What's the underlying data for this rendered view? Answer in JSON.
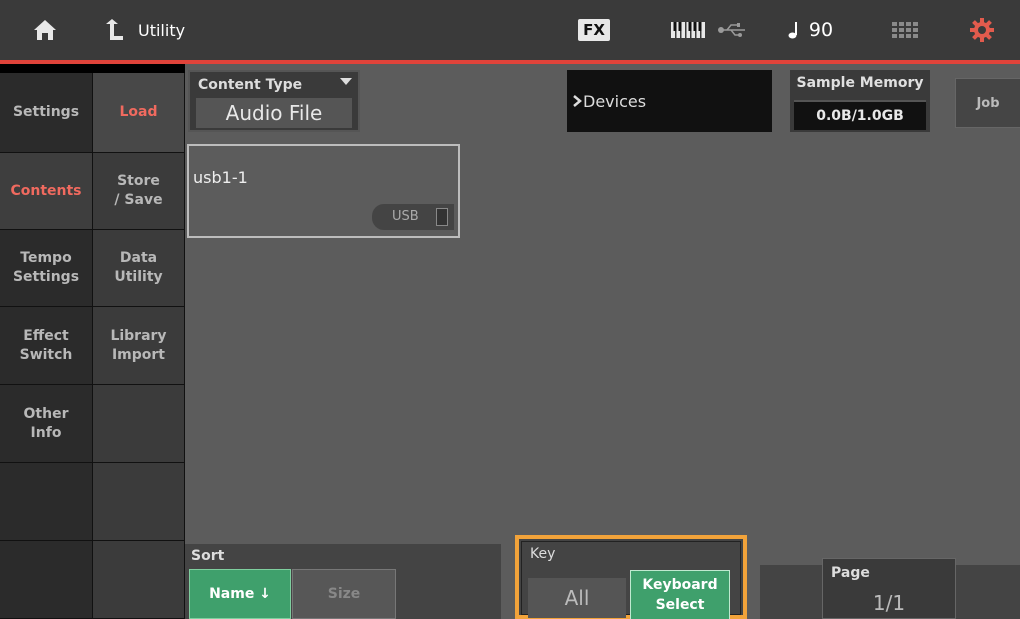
{
  "header": {
    "title": "Utility",
    "fx_label": "FX",
    "tempo": "90",
    "icons": [
      "home-icon",
      "back-arrow-icon",
      "keyboard-icon",
      "usb-icon",
      "note-icon",
      "grid-icon",
      "gear-icon"
    ]
  },
  "sidebar": {
    "main": [
      {
        "label": "Settings"
      },
      {
        "label": "Contents"
      },
      {
        "label": "Tempo\nSettings"
      },
      {
        "label": "Effect\nSwitch"
      },
      {
        "label": "Other\nInfo"
      }
    ],
    "sub": [
      {
        "label": "Load"
      },
      {
        "label": "Store\n/ Save"
      },
      {
        "label": "Data\nUtility"
      },
      {
        "label": "Library\nImport"
      }
    ]
  },
  "content_type": {
    "label": "Content Type",
    "value": "Audio File"
  },
  "devices": {
    "label": "Devices"
  },
  "sample_memory": {
    "label": "Sample Memory",
    "value": "0.0B/1.0GB"
  },
  "job": {
    "label": "Job"
  },
  "device_card": {
    "name": "usb1-1",
    "tag": "USB"
  },
  "sort": {
    "label": "Sort",
    "name_btn": "Name ↓",
    "size_btn": "Size"
  },
  "key": {
    "label": "Key",
    "all": "All",
    "keyboard_select": "Keyboard\nSelect"
  },
  "page": {
    "label": "Page",
    "value": "1/1"
  },
  "colors": {
    "accent_red": "#e0433a",
    "active_green": "#3fa06c",
    "highlight_orange": "#f2a33a"
  }
}
